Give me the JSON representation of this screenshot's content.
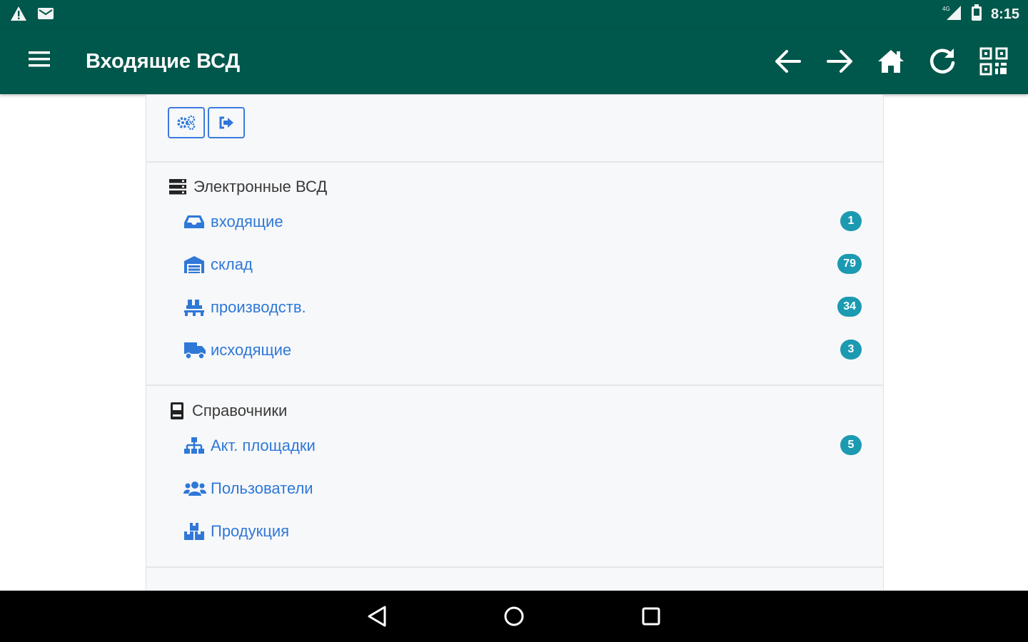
{
  "status_bar": {
    "time": "8:15",
    "network": "4G",
    "icons": [
      "warning-icon",
      "mail-icon",
      "signal-icon",
      "battery-icon"
    ]
  },
  "toolbar": {
    "title": "Входящие ВСД",
    "icons": [
      "menu-icon",
      "arrow-left-icon",
      "arrow-right-icon",
      "home-icon",
      "refresh-icon",
      "qr-code-icon"
    ]
  },
  "top_buttons": [
    "settings-icon",
    "logout-icon"
  ],
  "sections": [
    {
      "title": "Электронные ВСД",
      "icon": "database-icon",
      "items": [
        {
          "label": "входящие",
          "icon": "inbox-icon",
          "badge": "1"
        },
        {
          "label": "склад",
          "icon": "warehouse-icon",
          "badge": "79"
        },
        {
          "label": "производств.",
          "icon": "pallet-icon",
          "badge": "34"
        },
        {
          "label": "исходящие",
          "icon": "truck-icon",
          "badge": "3"
        }
      ]
    },
    {
      "title": "Справочники",
      "icon": "book-icon",
      "items": [
        {
          "label": "Акт. площадки",
          "icon": "sitemap-icon",
          "badge": "5"
        },
        {
          "label": "Пользователи",
          "icon": "users-icon",
          "badge": ""
        },
        {
          "label": "Продукция",
          "icon": "boxes-icon",
          "badge": ""
        }
      ]
    }
  ],
  "colors": {
    "app_bar": "#00574b",
    "link": "#2f78d8",
    "badge": "#1b9ab1",
    "card_bg": "#f7f8fa"
  }
}
